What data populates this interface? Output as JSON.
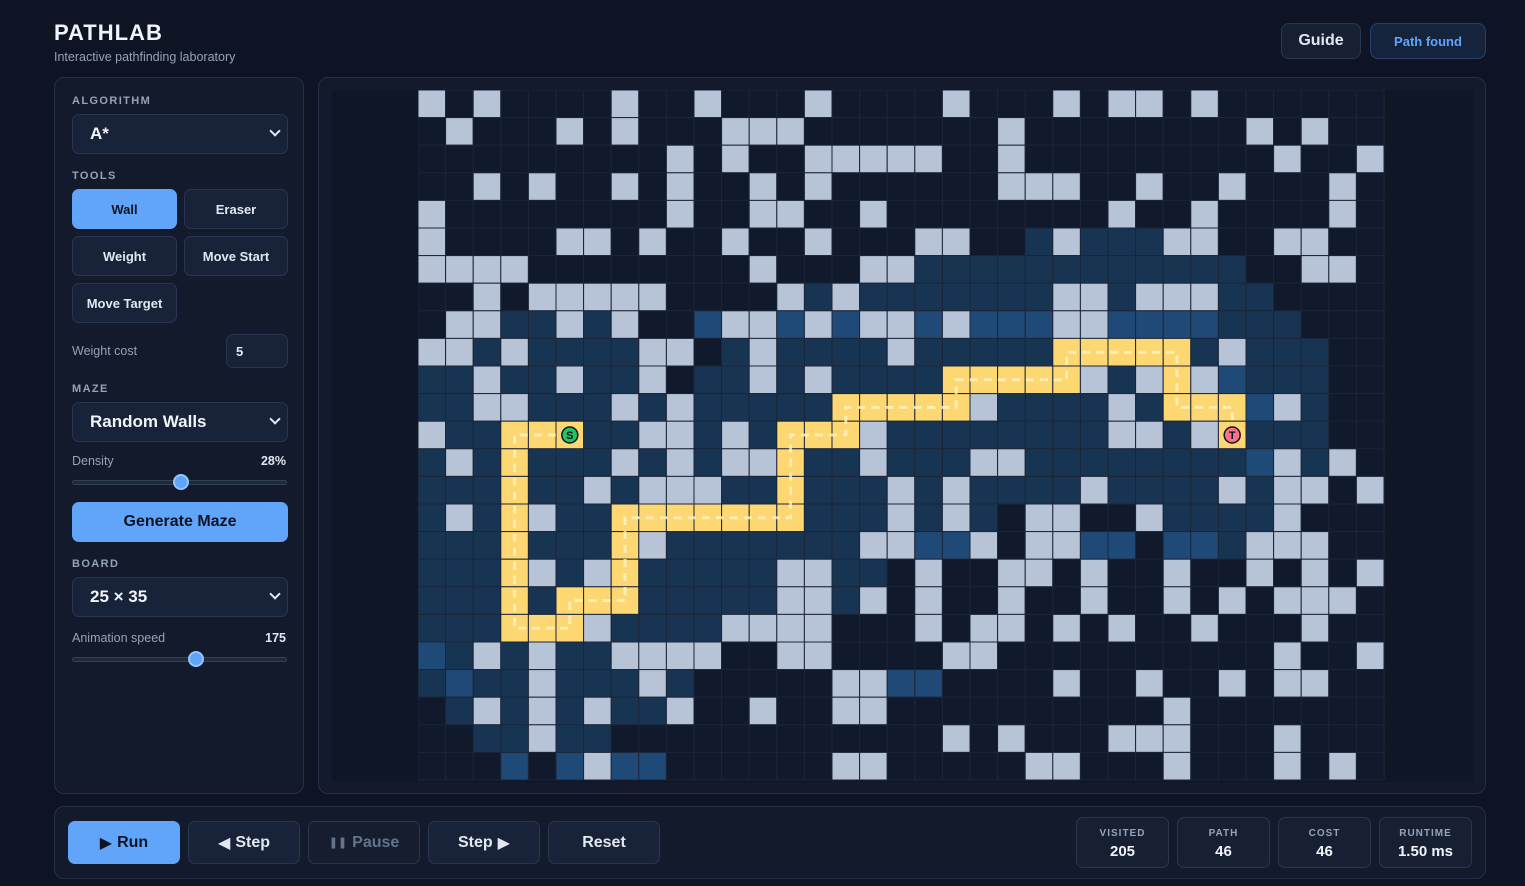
{
  "app": {
    "title": "PATHLAB",
    "subtitle": "Interactive pathfinding laboratory"
  },
  "header": {
    "guide_label": "Guide",
    "status_label": "Path found"
  },
  "sidebar": {
    "algorithm_heading": "ALGORITHM",
    "algorithm_value": "A*",
    "tools_heading": "TOOLS",
    "tools": [
      "Wall",
      "Eraser",
      "Weight",
      "Move Start",
      "Move Target"
    ],
    "active_tool": "Wall",
    "weight_cost_label": "Weight cost",
    "weight_cost_value": "5",
    "maze_heading": "MAZE",
    "maze_value": "Random Walls",
    "density_label": "Density",
    "density_value": "28%",
    "density_fraction": 0.5,
    "generate_label": "Generate Maze",
    "board_heading": "BOARD",
    "board_value": "25 × 35",
    "speed_label": "Animation speed",
    "speed_value": "175",
    "speed_fraction": 0.58
  },
  "grid": {
    "rows": 25,
    "cols": 35,
    "start": {
      "row": 12,
      "col": 5,
      "label": "S"
    },
    "target": {
      "row": 12,
      "col": 29,
      "label": "T"
    },
    "colors": {
      "empty": "#111a2c",
      "wall": "#b7c3d7",
      "visited": "#173552",
      "frontier": "#1f4a77",
      "path": "#fcd772",
      "start": "#22c55e",
      "target": "#fb7185",
      "gridline": "#1c2538"
    },
    "path": [
      [
        12,
        5
      ],
      [
        12,
        4
      ],
      [
        12,
        3
      ],
      [
        13,
        3
      ],
      [
        14,
        3
      ],
      [
        15,
        3
      ],
      [
        16,
        3
      ],
      [
        17,
        3
      ],
      [
        18,
        3
      ],
      [
        19,
        3
      ],
      [
        19,
        4
      ],
      [
        19,
        5
      ],
      [
        18,
        5
      ],
      [
        18,
        6
      ],
      [
        18,
        7
      ],
      [
        17,
        7
      ],
      [
        16,
        7
      ],
      [
        15,
        7
      ],
      [
        15,
        8
      ],
      [
        15,
        9
      ],
      [
        15,
        10
      ],
      [
        15,
        11
      ],
      [
        15,
        12
      ],
      [
        15,
        13
      ],
      [
        14,
        13
      ],
      [
        13,
        13
      ],
      [
        12,
        13
      ],
      [
        12,
        14
      ],
      [
        12,
        15
      ],
      [
        11,
        15
      ],
      [
        11,
        16
      ],
      [
        11,
        17
      ],
      [
        11,
        18
      ],
      [
        11,
        19
      ],
      [
        10,
        19
      ],
      [
        10,
        20
      ],
      [
        10,
        21
      ],
      [
        10,
        22
      ],
      [
        10,
        23
      ],
      [
        9,
        23
      ],
      [
        9,
        24
      ],
      [
        9,
        25
      ],
      [
        9,
        26
      ],
      [
        9,
        27
      ],
      [
        10,
        27
      ],
      [
        11,
        27
      ],
      [
        11,
        28
      ],
      [
        11,
        29
      ],
      [
        12,
        29
      ]
    ],
    "frontier": [
      [
        8,
        10
      ],
      [
        8,
        13
      ],
      [
        8,
        15
      ],
      [
        8,
        18
      ],
      [
        8,
        20
      ],
      [
        8,
        21
      ],
      [
        8,
        22
      ],
      [
        8,
        25
      ],
      [
        8,
        26
      ],
      [
        8,
        27
      ],
      [
        8,
        28
      ],
      [
        10,
        29
      ],
      [
        11,
        30
      ],
      [
        13,
        30
      ],
      [
        16,
        18
      ],
      [
        16,
        19
      ],
      [
        16,
        20
      ],
      [
        16,
        24
      ],
      [
        16,
        25
      ],
      [
        16,
        27
      ],
      [
        16,
        28
      ],
      [
        20,
        0
      ],
      [
        21,
        1
      ],
      [
        21,
        17
      ],
      [
        21,
        18
      ],
      [
        24,
        3
      ],
      [
        24,
        5
      ],
      [
        24,
        7
      ],
      [
        24,
        8
      ]
    ],
    "walls": [
      [
        0,
        0
      ],
      [
        0,
        2
      ],
      [
        0,
        7
      ],
      [
        0,
        10
      ],
      [
        0,
        14
      ],
      [
        0,
        19
      ],
      [
        0,
        23
      ],
      [
        0,
        25
      ],
      [
        0,
        26
      ],
      [
        0,
        28
      ],
      [
        1,
        1
      ],
      [
        1,
        5
      ],
      [
        1,
        7
      ],
      [
        1,
        11
      ],
      [
        1,
        12
      ],
      [
        1,
        13
      ],
      [
        1,
        21
      ],
      [
        1,
        30
      ],
      [
        1,
        32
      ],
      [
        2,
        9
      ],
      [
        2,
        11
      ],
      [
        2,
        14
      ],
      [
        2,
        15
      ],
      [
        2,
        16
      ],
      [
        2,
        17
      ],
      [
        2,
        18
      ],
      [
        2,
        21
      ],
      [
        2,
        31
      ],
      [
        2,
        34
      ],
      [
        3,
        2
      ],
      [
        3,
        4
      ],
      [
        3,
        7
      ],
      [
        3,
        9
      ],
      [
        3,
        12
      ],
      [
        3,
        14
      ],
      [
        3,
        21
      ],
      [
        3,
        22
      ],
      [
        3,
        23
      ],
      [
        3,
        26
      ],
      [
        3,
        29
      ],
      [
        3,
        33
      ],
      [
        4,
        0
      ],
      [
        4,
        9
      ],
      [
        4,
        12
      ],
      [
        4,
        13
      ],
      [
        4,
        16
      ],
      [
        4,
        25
      ],
      [
        4,
        28
      ],
      [
        4,
        33
      ],
      [
        5,
        0
      ],
      [
        5,
        5
      ],
      [
        5,
        6
      ],
      [
        5,
        8
      ],
      [
        5,
        11
      ],
      [
        5,
        14
      ],
      [
        5,
        18
      ],
      [
        5,
        19
      ],
      [
        5,
        23
      ],
      [
        5,
        27
      ],
      [
        5,
        28
      ],
      [
        5,
        31
      ],
      [
        5,
        32
      ],
      [
        6,
        0
      ],
      [
        6,
        1
      ],
      [
        6,
        2
      ],
      [
        6,
        3
      ],
      [
        6,
        12
      ],
      [
        6,
        16
      ],
      [
        6,
        17
      ],
      [
        6,
        32
      ],
      [
        6,
        33
      ],
      [
        7,
        2
      ],
      [
        7,
        4
      ],
      [
        7,
        5
      ],
      [
        7,
        6
      ],
      [
        7,
        7
      ],
      [
        7,
        8
      ],
      [
        7,
        13
      ],
      [
        7,
        15
      ],
      [
        7,
        23
      ],
      [
        7,
        24
      ],
      [
        7,
        26
      ],
      [
        7,
        27
      ],
      [
        7,
        28
      ],
      [
        8,
        1
      ],
      [
        8,
        2
      ],
      [
        8,
        5
      ],
      [
        8,
        7
      ],
      [
        8,
        11
      ],
      [
        8,
        12
      ],
      [
        8,
        14
      ],
      [
        8,
        16
      ],
      [
        8,
        17
      ],
      [
        8,
        19
      ],
      [
        8,
        23
      ],
      [
        8,
        24
      ],
      [
        9,
        0
      ],
      [
        9,
        1
      ],
      [
        9,
        3
      ],
      [
        9,
        8
      ],
      [
        9,
        9
      ],
      [
        9,
        12
      ],
      [
        9,
        17
      ],
      [
        9,
        29
      ],
      [
        10,
        2
      ],
      [
        10,
        5
      ],
      [
        10,
        8
      ],
      [
        10,
        12
      ],
      [
        10,
        14
      ],
      [
        10,
        24
      ],
      [
        10,
        26
      ],
      [
        10,
        28
      ],
      [
        11,
        2
      ],
      [
        11,
        3
      ],
      [
        11,
        7
      ],
      [
        11,
        9
      ],
      [
        11,
        20
      ],
      [
        11,
        25
      ],
      [
        11,
        31
      ],
      [
        12,
        0
      ],
      [
        12,
        8
      ],
      [
        12,
        9
      ],
      [
        12,
        11
      ],
      [
        12,
        16
      ],
      [
        12,
        25
      ],
      [
        12,
        26
      ],
      [
        12,
        28
      ],
      [
        13,
        1
      ],
      [
        13,
        7
      ],
      [
        13,
        9
      ],
      [
        13,
        11
      ],
      [
        13,
        12
      ],
      [
        13,
        16
      ],
      [
        13,
        20
      ],
      [
        13,
        21
      ],
      [
        13,
        31
      ],
      [
        13,
        33
      ],
      [
        14,
        6
      ],
      [
        14,
        8
      ],
      [
        14,
        9
      ],
      [
        14,
        10
      ],
      [
        14,
        17
      ],
      [
        14,
        19
      ],
      [
        14,
        24
      ],
      [
        14,
        29
      ],
      [
        14,
        31
      ],
      [
        14,
        32
      ],
      [
        14,
        34
      ],
      [
        15,
        1
      ],
      [
        15,
        4
      ],
      [
        15,
        17
      ],
      [
        15,
        19
      ],
      [
        15,
        22
      ],
      [
        15,
        23
      ],
      [
        15,
        26
      ],
      [
        15,
        31
      ],
      [
        16,
        8
      ],
      [
        16,
        16
      ],
      [
        16,
        17
      ],
      [
        16,
        20
      ],
      [
        16,
        22
      ],
      [
        16,
        23
      ],
      [
        16,
        30
      ],
      [
        16,
        31
      ],
      [
        16,
        32
      ],
      [
        17,
        4
      ],
      [
        17,
        6
      ],
      [
        17,
        13
      ],
      [
        17,
        14
      ],
      [
        17,
        18
      ],
      [
        17,
        21
      ],
      [
        17,
        22
      ],
      [
        17,
        24
      ],
      [
        17,
        27
      ],
      [
        17,
        30
      ],
      [
        17,
        32
      ],
      [
        17,
        34
      ],
      [
        18,
        6
      ],
      [
        18,
        13
      ],
      [
        18,
        14
      ],
      [
        18,
        16
      ],
      [
        18,
        18
      ],
      [
        18,
        21
      ],
      [
        18,
        24
      ],
      [
        18,
        27
      ],
      [
        18,
        29
      ],
      [
        18,
        31
      ],
      [
        18,
        32
      ],
      [
        18,
        33
      ],
      [
        19,
        6
      ],
      [
        19,
        11
      ],
      [
        19,
        12
      ],
      [
        19,
        13
      ],
      [
        19,
        14
      ],
      [
        19,
        18
      ],
      [
        19,
        20
      ],
      [
        19,
        21
      ],
      [
        19,
        23
      ],
      [
        19,
        25
      ],
      [
        19,
        28
      ],
      [
        19,
        32
      ],
      [
        20,
        2
      ],
      [
        20,
        4
      ],
      [
        20,
        7
      ],
      [
        20,
        8
      ],
      [
        20,
        9
      ],
      [
        20,
        10
      ],
      [
        20,
        13
      ],
      [
        20,
        14
      ],
      [
        20,
        19
      ],
      [
        20,
        20
      ],
      [
        20,
        31
      ],
      [
        20,
        34
      ],
      [
        21,
        4
      ],
      [
        21,
        8
      ],
      [
        21,
        15
      ],
      [
        21,
        16
      ],
      [
        21,
        23
      ],
      [
        21,
        26
      ],
      [
        21,
        29
      ],
      [
        21,
        31
      ],
      [
        21,
        32
      ],
      [
        22,
        2
      ],
      [
        22,
        4
      ],
      [
        22,
        6
      ],
      [
        22,
        9
      ],
      [
        22,
        12
      ],
      [
        22,
        15
      ],
      [
        22,
        16
      ],
      [
        22,
        27
      ],
      [
        23,
        4
      ],
      [
        23,
        19
      ],
      [
        23,
        21
      ],
      [
        23,
        25
      ],
      [
        23,
        26
      ],
      [
        23,
        27
      ],
      [
        23,
        31
      ],
      [
        24,
        6
      ],
      [
        24,
        15
      ],
      [
        24,
        16
      ],
      [
        24,
        22
      ],
      [
        24,
        23
      ],
      [
        24,
        27
      ],
      [
        24,
        31
      ],
      [
        24,
        33
      ],
      [
        25,
        2
      ],
      [
        25,
        9
      ],
      [
        25,
        14
      ],
      [
        25,
        17
      ],
      [
        25,
        19
      ],
      [
        25,
        20
      ],
      [
        25,
        28
      ],
      [
        25,
        33
      ]
    ]
  },
  "controls": {
    "run_label": "Run",
    "step_back_label": "Step",
    "pause_label": "Pause",
    "step_forward_label": "Step",
    "reset_label": "Reset"
  },
  "stats": [
    {
      "key": "VISITED",
      "value": "205"
    },
    {
      "key": "PATH",
      "value": "46"
    },
    {
      "key": "COST",
      "value": "46"
    },
    {
      "key": "RUNTIME",
      "value": "1.50 ms"
    }
  ]
}
